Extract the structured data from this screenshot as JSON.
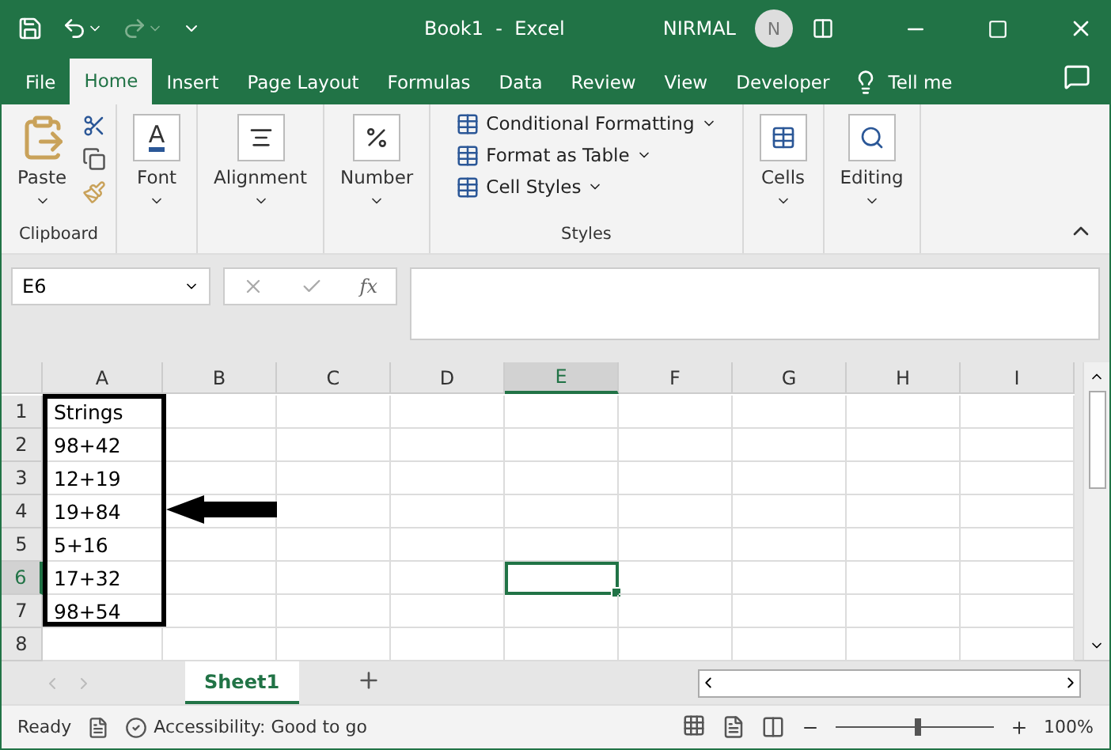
{
  "window": {
    "title": "Book1  -  Excel",
    "user": "NIRMAL",
    "avatar_initial": "N"
  },
  "tabs": [
    {
      "label": "File",
      "selected": false
    },
    {
      "label": "Home",
      "selected": true
    },
    {
      "label": "Insert",
      "selected": false
    },
    {
      "label": "Page Layout",
      "selected": false
    },
    {
      "label": "Formulas",
      "selected": false
    },
    {
      "label": "Data",
      "selected": false
    },
    {
      "label": "Review",
      "selected": false
    },
    {
      "label": "View",
      "selected": false
    },
    {
      "label": "Developer",
      "selected": false
    }
  ],
  "tell_me": "Tell me",
  "ribbon": {
    "clipboard": {
      "paste": "Paste",
      "label": "Clipboard"
    },
    "collapsed_groups": [
      {
        "label": "Font",
        "kind": "font",
        "icon_letter": "A"
      },
      {
        "label": "Alignment",
        "kind": "alignment"
      },
      {
        "label": "Number",
        "kind": "number"
      }
    ],
    "styles": {
      "items": [
        "Conditional Formatting",
        "Format as Table",
        "Cell Styles"
      ],
      "label": "Styles"
    },
    "right_groups": [
      {
        "label": "Cells",
        "kind": "cells"
      },
      {
        "label": "Editing",
        "kind": "editing"
      }
    ]
  },
  "name_box": "E6",
  "function_button": "fx",
  "columns": [
    {
      "label": "A",
      "selected": false
    },
    {
      "label": "B",
      "selected": false
    },
    {
      "label": "C",
      "selected": false
    },
    {
      "label": "D",
      "selected": false
    },
    {
      "label": "E",
      "selected": true
    },
    {
      "label": "F",
      "selected": false
    },
    {
      "label": "G",
      "selected": false
    },
    {
      "label": "H",
      "selected": false
    },
    {
      "label": "I",
      "selected": false
    }
  ],
  "rows": [
    {
      "number": "1",
      "selected": false,
      "values": [
        "Strings"
      ]
    },
    {
      "number": "2",
      "selected": false,
      "values": [
        "98+42"
      ]
    },
    {
      "number": "3",
      "selected": false,
      "values": [
        "12+19"
      ]
    },
    {
      "number": "4",
      "selected": false,
      "values": [
        "19+84"
      ]
    },
    {
      "number": "5",
      "selected": false,
      "values": [
        "5+16"
      ]
    },
    {
      "number": "6",
      "selected": true,
      "values": [
        "17+32"
      ]
    },
    {
      "number": "7",
      "selected": false,
      "values": [
        "98+54"
      ]
    },
    {
      "number": "8",
      "selected": false,
      "values": []
    }
  ],
  "sheets": [
    {
      "label": "Sheet1",
      "selected": true
    }
  ],
  "status_bar": {
    "ready": "Ready",
    "accessibility": "Accessibility: Good to go",
    "zoom": {
      "level": 0.52,
      "reading": "100%"
    }
  }
}
